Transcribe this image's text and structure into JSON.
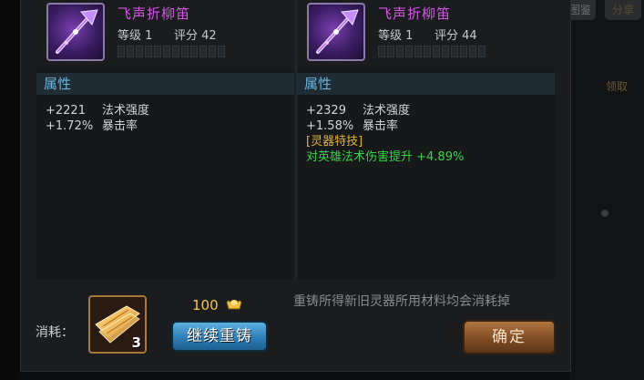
{
  "background_labels": [
    "图鉴",
    "分享",
    "领取"
  ],
  "left_item": {
    "name": "飞声折柳笛",
    "level_text": "等级 1",
    "score_text": "评分 42",
    "pips_total": 12,
    "attr_title": "属性",
    "attributes": [
      {
        "value": "+2221",
        "name": "法术强度"
      },
      {
        "value": "+1.72%",
        "name": "暴击率"
      }
    ]
  },
  "right_item": {
    "name": "飞声折柳笛",
    "level_text": "等级 1",
    "score_text": "评分 44",
    "pips_total": 12,
    "attr_title": "属性",
    "attributes": [
      {
        "value": "+2329",
        "name": "法术强度"
      },
      {
        "value": "+1.58%",
        "name": "暴击率"
      }
    ],
    "skill_title": "[灵器特技]",
    "skill_effect": "对英雄法术伤害提升 +4.89%"
  },
  "bottom": {
    "cost_label": "消耗：",
    "material_count": "3",
    "gold_cost": "100",
    "reforge_button": "继续重铸",
    "notice": "重铸所得新旧灵器所用材料均会消耗掉",
    "confirm_button": "确定"
  },
  "colors": {
    "item_name": "#d457e6",
    "attr_header": "#6fb3da",
    "skill_title": "#e0b23a",
    "skill_effect": "#38d24a",
    "reforge_button": "#2f7fb8",
    "confirm_button": "#7d4a24"
  }
}
